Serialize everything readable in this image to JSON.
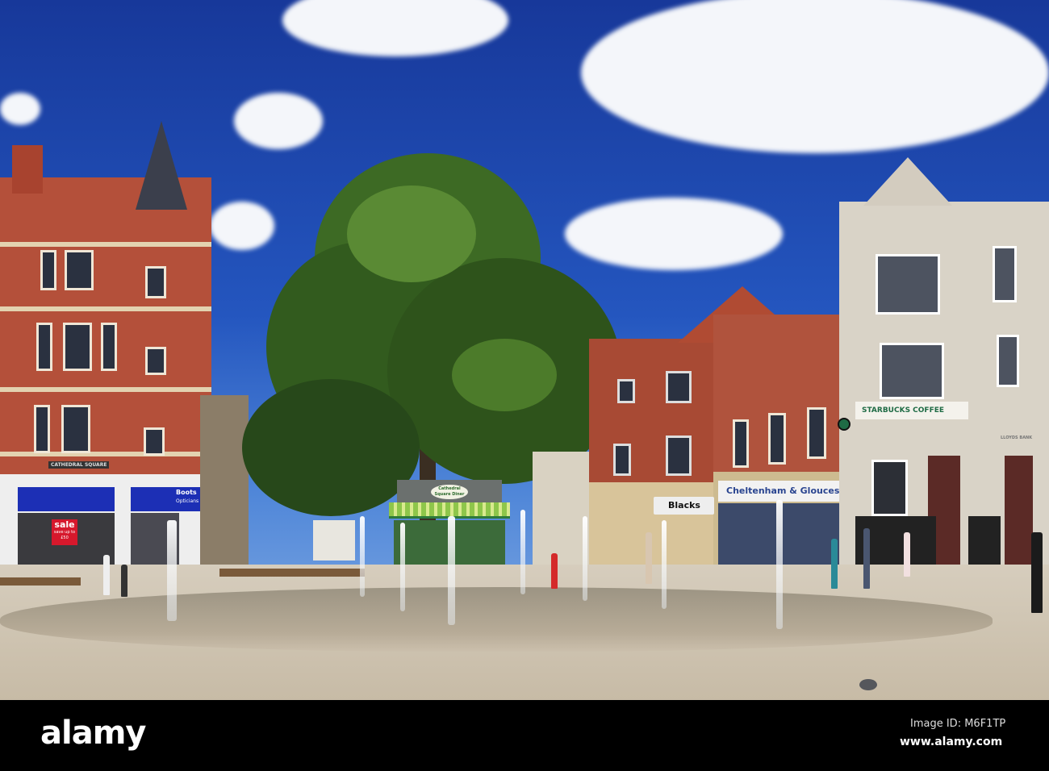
{
  "signs": {
    "cathedral_square": "CATHEDRAL SQUARE",
    "sale": "sale",
    "sale_sub": "save up to £50",
    "boots": "Boots",
    "opticians": "Opticians",
    "diner": "Cathedral Square Diner",
    "blacks": "Blacks",
    "cheltenham": "Cheltenham & Gloucester",
    "starbucks": "STARBUCKS COFFEE",
    "lloyds": "LLOYDS BANK"
  },
  "watermark": {
    "logo": "alamy",
    "image_id": "Image ID: M6F1TP",
    "url": "www.alamy.com"
  },
  "colors": {
    "sky": "#2456bf",
    "brick": "#b4503a",
    "stone": "#d9d3c7",
    "boots_blue": "#1c2fb5",
    "starbucks_green": "#1f6b45"
  }
}
